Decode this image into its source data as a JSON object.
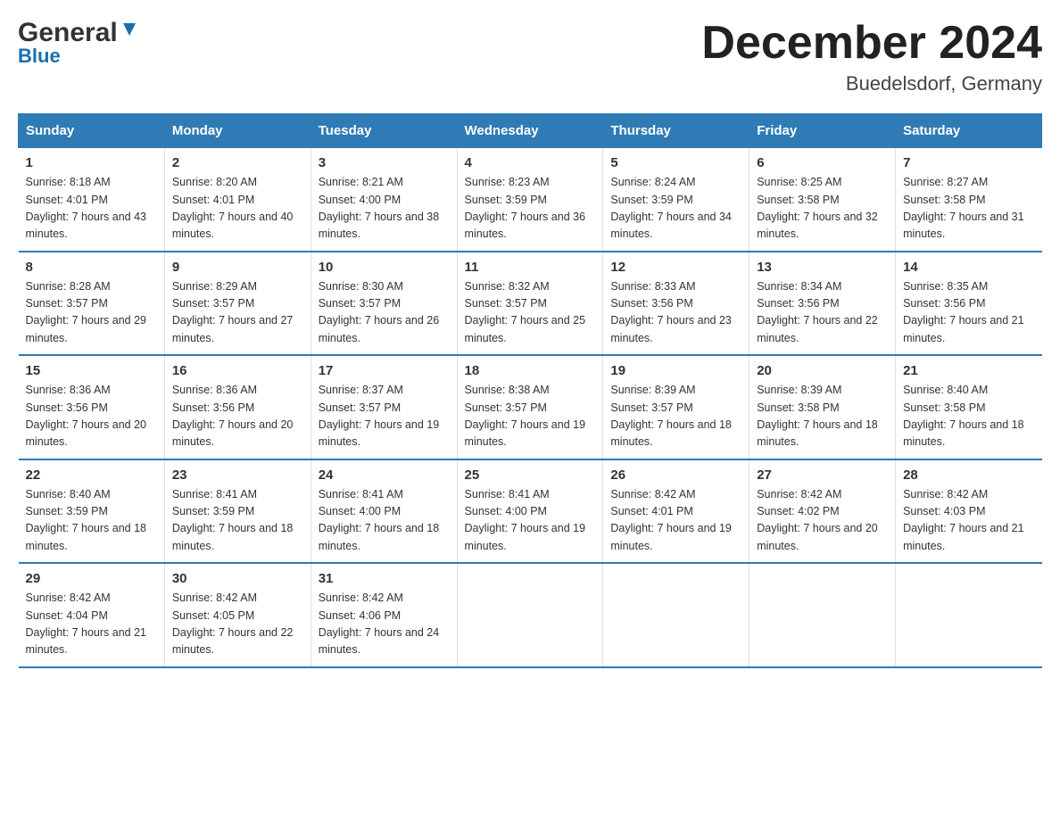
{
  "header": {
    "logo_general": "General",
    "logo_blue": "Blue",
    "month_title": "December 2024",
    "location": "Buedelsdorf, Germany"
  },
  "days_of_week": [
    "Sunday",
    "Monday",
    "Tuesday",
    "Wednesday",
    "Thursday",
    "Friday",
    "Saturday"
  ],
  "weeks": [
    [
      {
        "day": "1",
        "sunrise": "8:18 AM",
        "sunset": "4:01 PM",
        "daylight": "7 hours and 43 minutes."
      },
      {
        "day": "2",
        "sunrise": "8:20 AM",
        "sunset": "4:01 PM",
        "daylight": "7 hours and 40 minutes."
      },
      {
        "day": "3",
        "sunrise": "8:21 AM",
        "sunset": "4:00 PM",
        "daylight": "7 hours and 38 minutes."
      },
      {
        "day": "4",
        "sunrise": "8:23 AM",
        "sunset": "3:59 PM",
        "daylight": "7 hours and 36 minutes."
      },
      {
        "day": "5",
        "sunrise": "8:24 AM",
        "sunset": "3:59 PM",
        "daylight": "7 hours and 34 minutes."
      },
      {
        "day": "6",
        "sunrise": "8:25 AM",
        "sunset": "3:58 PM",
        "daylight": "7 hours and 32 minutes."
      },
      {
        "day": "7",
        "sunrise": "8:27 AM",
        "sunset": "3:58 PM",
        "daylight": "7 hours and 31 minutes."
      }
    ],
    [
      {
        "day": "8",
        "sunrise": "8:28 AM",
        "sunset": "3:57 PM",
        "daylight": "7 hours and 29 minutes."
      },
      {
        "day": "9",
        "sunrise": "8:29 AM",
        "sunset": "3:57 PM",
        "daylight": "7 hours and 27 minutes."
      },
      {
        "day": "10",
        "sunrise": "8:30 AM",
        "sunset": "3:57 PM",
        "daylight": "7 hours and 26 minutes."
      },
      {
        "day": "11",
        "sunrise": "8:32 AM",
        "sunset": "3:57 PM",
        "daylight": "7 hours and 25 minutes."
      },
      {
        "day": "12",
        "sunrise": "8:33 AM",
        "sunset": "3:56 PM",
        "daylight": "7 hours and 23 minutes."
      },
      {
        "day": "13",
        "sunrise": "8:34 AM",
        "sunset": "3:56 PM",
        "daylight": "7 hours and 22 minutes."
      },
      {
        "day": "14",
        "sunrise": "8:35 AM",
        "sunset": "3:56 PM",
        "daylight": "7 hours and 21 minutes."
      }
    ],
    [
      {
        "day": "15",
        "sunrise": "8:36 AM",
        "sunset": "3:56 PM",
        "daylight": "7 hours and 20 minutes."
      },
      {
        "day": "16",
        "sunrise": "8:36 AM",
        "sunset": "3:56 PM",
        "daylight": "7 hours and 20 minutes."
      },
      {
        "day": "17",
        "sunrise": "8:37 AM",
        "sunset": "3:57 PM",
        "daylight": "7 hours and 19 minutes."
      },
      {
        "day": "18",
        "sunrise": "8:38 AM",
        "sunset": "3:57 PM",
        "daylight": "7 hours and 19 minutes."
      },
      {
        "day": "19",
        "sunrise": "8:39 AM",
        "sunset": "3:57 PM",
        "daylight": "7 hours and 18 minutes."
      },
      {
        "day": "20",
        "sunrise": "8:39 AM",
        "sunset": "3:58 PM",
        "daylight": "7 hours and 18 minutes."
      },
      {
        "day": "21",
        "sunrise": "8:40 AM",
        "sunset": "3:58 PM",
        "daylight": "7 hours and 18 minutes."
      }
    ],
    [
      {
        "day": "22",
        "sunrise": "8:40 AM",
        "sunset": "3:59 PM",
        "daylight": "7 hours and 18 minutes."
      },
      {
        "day": "23",
        "sunrise": "8:41 AM",
        "sunset": "3:59 PM",
        "daylight": "7 hours and 18 minutes."
      },
      {
        "day": "24",
        "sunrise": "8:41 AM",
        "sunset": "4:00 PM",
        "daylight": "7 hours and 18 minutes."
      },
      {
        "day": "25",
        "sunrise": "8:41 AM",
        "sunset": "4:00 PM",
        "daylight": "7 hours and 19 minutes."
      },
      {
        "day": "26",
        "sunrise": "8:42 AM",
        "sunset": "4:01 PM",
        "daylight": "7 hours and 19 minutes."
      },
      {
        "day": "27",
        "sunrise": "8:42 AM",
        "sunset": "4:02 PM",
        "daylight": "7 hours and 20 minutes."
      },
      {
        "day": "28",
        "sunrise": "8:42 AM",
        "sunset": "4:03 PM",
        "daylight": "7 hours and 21 minutes."
      }
    ],
    [
      {
        "day": "29",
        "sunrise": "8:42 AM",
        "sunset": "4:04 PM",
        "daylight": "7 hours and 21 minutes."
      },
      {
        "day": "30",
        "sunrise": "8:42 AM",
        "sunset": "4:05 PM",
        "daylight": "7 hours and 22 minutes."
      },
      {
        "day": "31",
        "sunrise": "8:42 AM",
        "sunset": "4:06 PM",
        "daylight": "7 hours and 24 minutes."
      },
      {
        "day": "",
        "sunrise": "",
        "sunset": "",
        "daylight": ""
      },
      {
        "day": "",
        "sunrise": "",
        "sunset": "",
        "daylight": ""
      },
      {
        "day": "",
        "sunrise": "",
        "sunset": "",
        "daylight": ""
      },
      {
        "day": "",
        "sunrise": "",
        "sunset": "",
        "daylight": ""
      }
    ]
  ],
  "labels": {
    "sunrise": "Sunrise:",
    "sunset": "Sunset:",
    "daylight": "Daylight:"
  }
}
